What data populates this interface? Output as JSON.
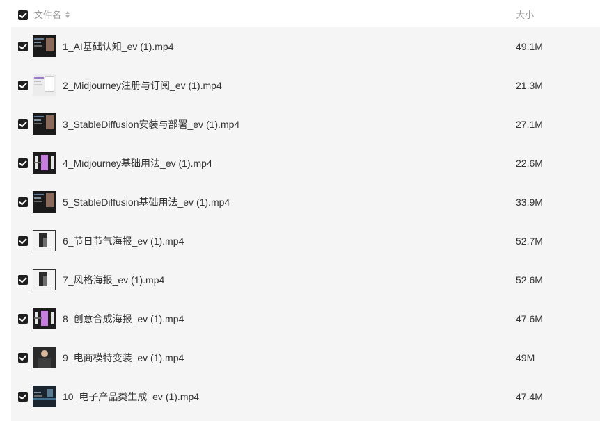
{
  "header": {
    "name_label": "文件名",
    "size_label": "大小",
    "select_all_checked": true
  },
  "files": [
    {
      "name": "1_AI基础认知_ev (1).mp4",
      "size": "49.1M",
      "checked": true,
      "thumb": "video-thumbnail"
    },
    {
      "name": "2_Midjourney注册与订阅_ev (1).mp4",
      "size": "21.3M",
      "checked": true,
      "thumb": "video-thumbnail"
    },
    {
      "name": "3_StableDiffusion安装与部署_ev (1).mp4",
      "size": "27.1M",
      "checked": true,
      "thumb": "video-thumbnail"
    },
    {
      "name": "4_Midjourney基础用法_ev (1).mp4",
      "size": "22.6M",
      "checked": true,
      "thumb": "video-thumbnail"
    },
    {
      "name": "5_StableDiffusion基础用法_ev (1).mp4",
      "size": "33.9M",
      "checked": true,
      "thumb": "video-thumbnail"
    },
    {
      "name": "6_节日节气海报_ev (1).mp4",
      "size": "52.7M",
      "checked": true,
      "thumb": "video-thumbnail"
    },
    {
      "name": "7_风格海报_ev (1).mp4",
      "size": "52.6M",
      "checked": true,
      "thumb": "video-thumbnail"
    },
    {
      "name": "8_创意合成海报_ev (1).mp4",
      "size": "47.6M",
      "checked": true,
      "thumb": "video-thumbnail"
    },
    {
      "name": "9_电商模特变装_ev (1).mp4",
      "size": "49M",
      "checked": true,
      "thumb": "video-thumbnail"
    },
    {
      "name": "10_电子产品类生成_ev (1).mp4",
      "size": "47.4M",
      "checked": true,
      "thumb": "video-thumbnail"
    }
  ],
  "colors": {
    "row_background": "#f5f5f5",
    "checkbox_fill": "#1f1f1f",
    "text_primary": "#333333",
    "text_header": "#9a9a9a"
  }
}
